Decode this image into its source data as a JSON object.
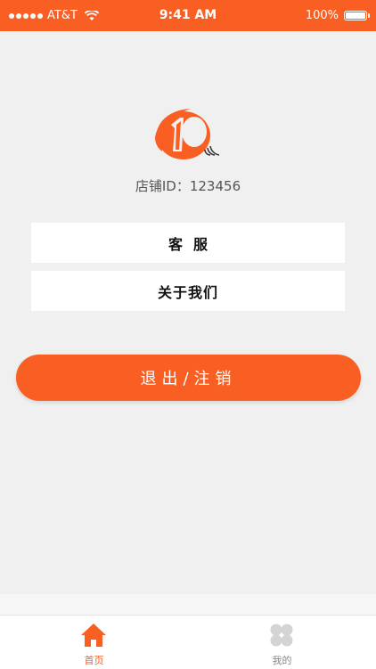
{
  "status_bar": {
    "carrier": "AT&T",
    "time": "9:41 AM",
    "battery": "100%"
  },
  "store": {
    "id_text": "店铺ID：123456"
  },
  "menu": {
    "service_label": "客服",
    "about_label": "关于我们"
  },
  "logout": {
    "label": "退出/注销"
  },
  "tab_bar": {
    "home_label": "首页",
    "mine_label": "我的",
    "active_tab": "首页"
  },
  "colors": {
    "brand": "#f95f23",
    "background": "#f0f0f0",
    "card": "#ffffff",
    "inactive_icon": "#d4d4d4"
  },
  "icons": [
    "wifi-icon",
    "battery-icon",
    "brand-logo",
    "home-icon",
    "clover-icon"
  ]
}
